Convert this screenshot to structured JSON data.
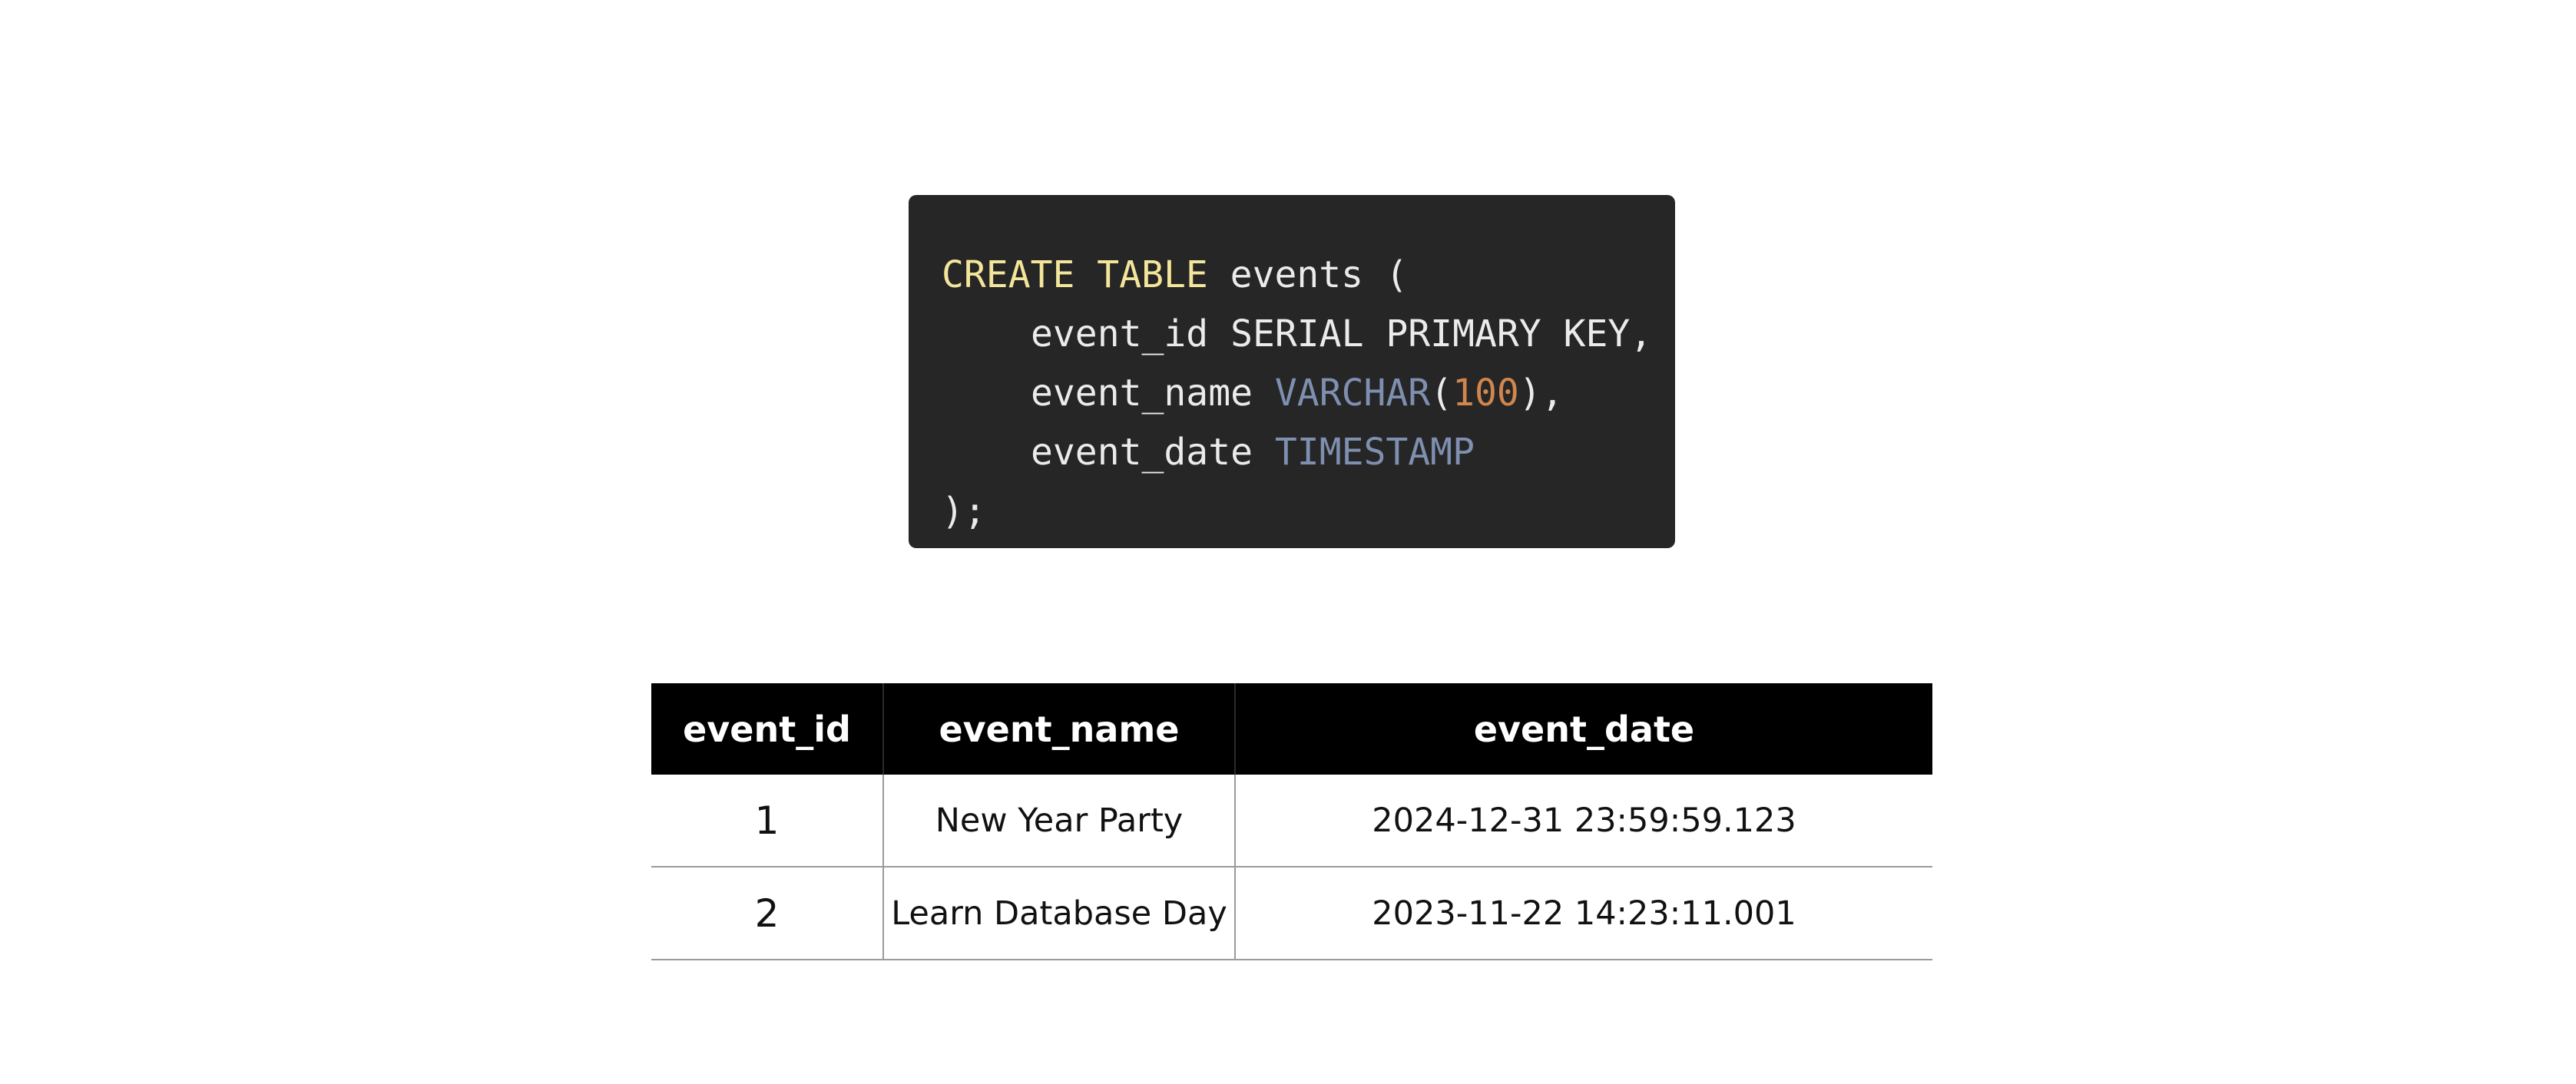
{
  "code": {
    "line1": {
      "kw": "CREATE TABLE",
      "rest": " events ("
    },
    "line2": {
      "text": "event_id SERIAL PRIMARY KEY,"
    },
    "line3": {
      "name": "event_name ",
      "type": "VARCHAR",
      "open": "(",
      "num": "100",
      "close": "),"
    },
    "line4": {
      "name": "event_date ",
      "type": "TIMESTAMP"
    },
    "line5": {
      "text": ");"
    }
  },
  "table": {
    "headers": [
      "event_id",
      "event_name",
      "event_date"
    ],
    "rows": [
      [
        "1",
        "New Year Party",
        "2024-12-31 23:59:59.123"
      ],
      [
        "2",
        "Learn Database Day",
        "2023-11-22 14:23:11.001"
      ]
    ]
  },
  "colors": {
    "code_background": "#262626",
    "keyword": "#f3e59a",
    "type": "#7f8fb0",
    "number": "#d1864d",
    "table_header_background": "#000000"
  }
}
